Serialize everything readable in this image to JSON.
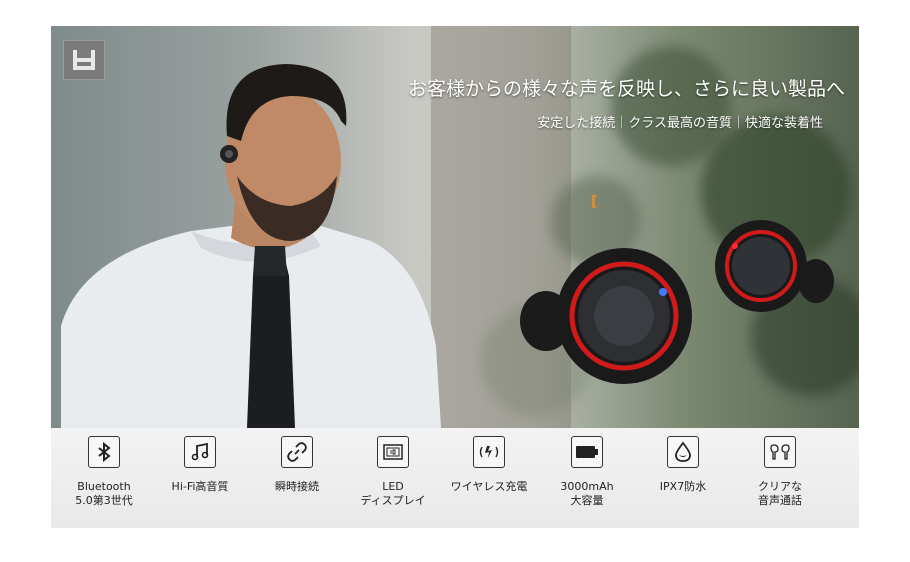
{
  "banner": {
    "logo_letter": "H",
    "headline": "お客様からの様々な声を反映し、さらに良い製品へ",
    "subline": "安定した接続｜クラス最高の音質｜快適な装着性",
    "bracket": "["
  },
  "features": [
    {
      "icon": "bluetooth-icon",
      "line1": "Bluetooth",
      "line2": "5.0第3世代"
    },
    {
      "icon": "music-note-icon",
      "line1": "Hi-Fi高音質",
      "line2": ""
    },
    {
      "icon": "link-icon",
      "line1": "瞬時接続",
      "line2": ""
    },
    {
      "icon": "led-display-icon",
      "line1": "LED",
      "line2": "ディスプレイ"
    },
    {
      "icon": "wireless-charging-icon",
      "line1": "ワイヤレス充電",
      "line2": ""
    },
    {
      "icon": "battery-icon",
      "line1": "3000mAh",
      "line2": "大容量"
    },
    {
      "icon": "waterdrop-icon",
      "line1": "IPX7防水",
      "line2": ""
    },
    {
      "icon": "earbuds-icon",
      "line1": "クリアな",
      "line2": "音声通話"
    }
  ]
}
